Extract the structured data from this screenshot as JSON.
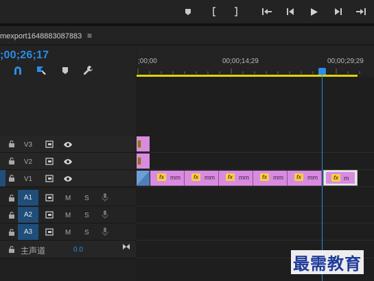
{
  "transport": {
    "buttons": [
      "marker-icon",
      "mark-in-icon",
      "mark-out-icon",
      "go-to-in-icon",
      "step-back-icon",
      "play-icon",
      "step-forward-icon",
      "go-to-out-icon"
    ]
  },
  "sequence": {
    "title": "mexport1648883087883",
    "menu_glyph": "≡",
    "timecode": ";00;26;17"
  },
  "ruler": {
    "labels": [
      ";00;00",
      "00;00;14;29",
      "00;00;29;29"
    ]
  },
  "tracks": {
    "video": [
      {
        "label": "V3",
        "active": false
      },
      {
        "label": "V2",
        "active": false
      },
      {
        "label": "V1",
        "active": true
      }
    ],
    "audio": [
      {
        "label": "A1",
        "m": "M",
        "s": "S"
      },
      {
        "label": "A2",
        "m": "M",
        "s": "S"
      },
      {
        "label": "A3",
        "m": "M",
        "s": "S"
      }
    ],
    "master": {
      "label": "主声道",
      "value": "0.0"
    }
  },
  "clips": {
    "fx_label": "fx",
    "items": [
      {
        "name": "mm"
      },
      {
        "name": "mm"
      },
      {
        "name": "mm"
      },
      {
        "name": "mm"
      },
      {
        "name": "mm"
      },
      {
        "name": "m",
        "selected": true
      }
    ]
  },
  "watermark": "最需教育",
  "colors": {
    "accent": "#2d8ceb",
    "clip": "#d98be0",
    "work_area": "#e1d400",
    "active_track": "#1f4e7a"
  }
}
